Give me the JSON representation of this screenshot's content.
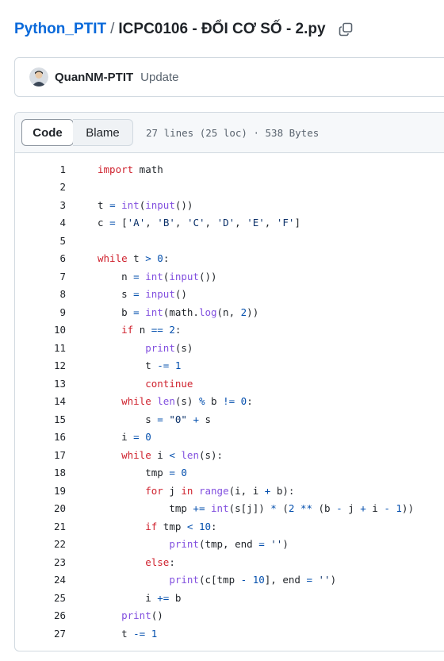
{
  "breadcrumb": {
    "repo": "Python_PTIT",
    "separator": "/",
    "file": "ICPC0106 - ĐỔI CƠ SỐ - 2.py"
  },
  "commit": {
    "author": "QuanNM-PTIT",
    "message": "Update"
  },
  "file_header": {
    "tab_code": "Code",
    "tab_blame": "Blame",
    "info": "27 lines (25 loc) · 538 Bytes"
  },
  "code_lines": [
    {
      "n": "1",
      "t": [
        [
          "kw",
          "import"
        ],
        [
          "p",
          " math"
        ]
      ]
    },
    {
      "n": "2",
      "t": []
    },
    {
      "n": "3",
      "t": [
        [
          "p",
          "t "
        ],
        [
          "op",
          "="
        ],
        [
          "p",
          " "
        ],
        [
          "fn",
          "int"
        ],
        [
          "p",
          "("
        ],
        [
          "fn",
          "input"
        ],
        [
          "p",
          "())"
        ]
      ]
    },
    {
      "n": "4",
      "t": [
        [
          "p",
          "c "
        ],
        [
          "op",
          "="
        ],
        [
          "p",
          " ["
        ],
        [
          "str",
          "'A'"
        ],
        [
          "p",
          ", "
        ],
        [
          "str",
          "'B'"
        ],
        [
          "p",
          ", "
        ],
        [
          "str",
          "'C'"
        ],
        [
          "p",
          ", "
        ],
        [
          "str",
          "'D'"
        ],
        [
          "p",
          ", "
        ],
        [
          "str",
          "'E'"
        ],
        [
          "p",
          ", "
        ],
        [
          "str",
          "'F'"
        ],
        [
          "p",
          "]"
        ]
      ]
    },
    {
      "n": "5",
      "t": []
    },
    {
      "n": "6",
      "t": [
        [
          "kw",
          "while"
        ],
        [
          "p",
          " t "
        ],
        [
          "op",
          ">"
        ],
        [
          "p",
          " "
        ],
        [
          "num",
          "0"
        ],
        [
          "p",
          ":"
        ]
      ]
    },
    {
      "n": "7",
      "t": [
        [
          "p",
          "    n "
        ],
        [
          "op",
          "="
        ],
        [
          "p",
          " "
        ],
        [
          "fn",
          "int"
        ],
        [
          "p",
          "("
        ],
        [
          "fn",
          "input"
        ],
        [
          "p",
          "())"
        ]
      ]
    },
    {
      "n": "8",
      "t": [
        [
          "p",
          "    s "
        ],
        [
          "op",
          "="
        ],
        [
          "p",
          " "
        ],
        [
          "fn",
          "input"
        ],
        [
          "p",
          "()"
        ]
      ]
    },
    {
      "n": "9",
      "t": [
        [
          "p",
          "    b "
        ],
        [
          "op",
          "="
        ],
        [
          "p",
          " "
        ],
        [
          "fn",
          "int"
        ],
        [
          "p",
          "(math."
        ],
        [
          "fn",
          "log"
        ],
        [
          "p",
          "(n, "
        ],
        [
          "num",
          "2"
        ],
        [
          "p",
          "))"
        ]
      ]
    },
    {
      "n": "10",
      "t": [
        [
          "p",
          "    "
        ],
        [
          "kw",
          "if"
        ],
        [
          "p",
          " n "
        ],
        [
          "op",
          "=="
        ],
        [
          "p",
          " "
        ],
        [
          "num",
          "2"
        ],
        [
          "p",
          ":"
        ]
      ]
    },
    {
      "n": "11",
      "t": [
        [
          "p",
          "        "
        ],
        [
          "fn",
          "print"
        ],
        [
          "p",
          "(s)"
        ]
      ]
    },
    {
      "n": "12",
      "t": [
        [
          "p",
          "        t "
        ],
        [
          "op",
          "-="
        ],
        [
          "p",
          " "
        ],
        [
          "num",
          "1"
        ]
      ]
    },
    {
      "n": "13",
      "t": [
        [
          "p",
          "        "
        ],
        [
          "kw",
          "continue"
        ]
      ]
    },
    {
      "n": "14",
      "t": [
        [
          "p",
          "    "
        ],
        [
          "kw",
          "while"
        ],
        [
          "p",
          " "
        ],
        [
          "fn",
          "len"
        ],
        [
          "p",
          "(s) "
        ],
        [
          "op",
          "%"
        ],
        [
          "p",
          " b "
        ],
        [
          "op",
          "!="
        ],
        [
          "p",
          " "
        ],
        [
          "num",
          "0"
        ],
        [
          "p",
          ":"
        ]
      ]
    },
    {
      "n": "15",
      "t": [
        [
          "p",
          "        s "
        ],
        [
          "op",
          "="
        ],
        [
          "p",
          " "
        ],
        [
          "str",
          "\"0\""
        ],
        [
          "p",
          " "
        ],
        [
          "op",
          "+"
        ],
        [
          "p",
          " s"
        ]
      ]
    },
    {
      "n": "16",
      "t": [
        [
          "p",
          "    i "
        ],
        [
          "op",
          "="
        ],
        [
          "p",
          " "
        ],
        [
          "num",
          "0"
        ]
      ]
    },
    {
      "n": "17",
      "t": [
        [
          "p",
          "    "
        ],
        [
          "kw",
          "while"
        ],
        [
          "p",
          " i "
        ],
        [
          "op",
          "<"
        ],
        [
          "p",
          " "
        ],
        [
          "fn",
          "len"
        ],
        [
          "p",
          "(s):"
        ]
      ]
    },
    {
      "n": "18",
      "t": [
        [
          "p",
          "        tmp "
        ],
        [
          "op",
          "="
        ],
        [
          "p",
          " "
        ],
        [
          "num",
          "0"
        ]
      ]
    },
    {
      "n": "19",
      "t": [
        [
          "p",
          "        "
        ],
        [
          "kw",
          "for"
        ],
        [
          "p",
          " j "
        ],
        [
          "kw",
          "in"
        ],
        [
          "p",
          " "
        ],
        [
          "fn",
          "range"
        ],
        [
          "p",
          "(i, i "
        ],
        [
          "op",
          "+"
        ],
        [
          "p",
          " b):"
        ]
      ]
    },
    {
      "n": "20",
      "t": [
        [
          "p",
          "            tmp "
        ],
        [
          "op",
          "+="
        ],
        [
          "p",
          " "
        ],
        [
          "fn",
          "int"
        ],
        [
          "p",
          "(s[j]) "
        ],
        [
          "op",
          "*"
        ],
        [
          "p",
          " ("
        ],
        [
          "num",
          "2"
        ],
        [
          "p",
          " "
        ],
        [
          "op",
          "**"
        ],
        [
          "p",
          " (b "
        ],
        [
          "op",
          "-"
        ],
        [
          "p",
          " j "
        ],
        [
          "op",
          "+"
        ],
        [
          "p",
          " i "
        ],
        [
          "op",
          "-"
        ],
        [
          "p",
          " "
        ],
        [
          "num",
          "1"
        ],
        [
          "p",
          "))"
        ]
      ]
    },
    {
      "n": "21",
      "t": [
        [
          "p",
          "        "
        ],
        [
          "kw",
          "if"
        ],
        [
          "p",
          " tmp "
        ],
        [
          "op",
          "<"
        ],
        [
          "p",
          " "
        ],
        [
          "num",
          "10"
        ],
        [
          "p",
          ":"
        ]
      ]
    },
    {
      "n": "22",
      "t": [
        [
          "p",
          "            "
        ],
        [
          "fn",
          "print"
        ],
        [
          "p",
          "(tmp, end "
        ],
        [
          "op",
          "="
        ],
        [
          "p",
          " "
        ],
        [
          "str",
          "''"
        ],
        [
          "p",
          ")"
        ]
      ]
    },
    {
      "n": "23",
      "t": [
        [
          "p",
          "        "
        ],
        [
          "kw",
          "else"
        ],
        [
          "p",
          ":"
        ]
      ]
    },
    {
      "n": "24",
      "t": [
        [
          "p",
          "            "
        ],
        [
          "fn",
          "print"
        ],
        [
          "p",
          "(c[tmp "
        ],
        [
          "op",
          "-"
        ],
        [
          "p",
          " "
        ],
        [
          "num",
          "10"
        ],
        [
          "p",
          "], end "
        ],
        [
          "op",
          "="
        ],
        [
          "p",
          " "
        ],
        [
          "str",
          "''"
        ],
        [
          "p",
          ")"
        ]
      ]
    },
    {
      "n": "25",
      "t": [
        [
          "p",
          "        i "
        ],
        [
          "op",
          "+="
        ],
        [
          "p",
          " b"
        ]
      ]
    },
    {
      "n": "26",
      "t": [
        [
          "p",
          "    "
        ],
        [
          "fn",
          "print"
        ],
        [
          "p",
          "()"
        ]
      ]
    },
    {
      "n": "27",
      "t": [
        [
          "p",
          "    t "
        ],
        [
          "op",
          "-="
        ],
        [
          "p",
          " "
        ],
        [
          "num",
          "1"
        ]
      ]
    }
  ]
}
